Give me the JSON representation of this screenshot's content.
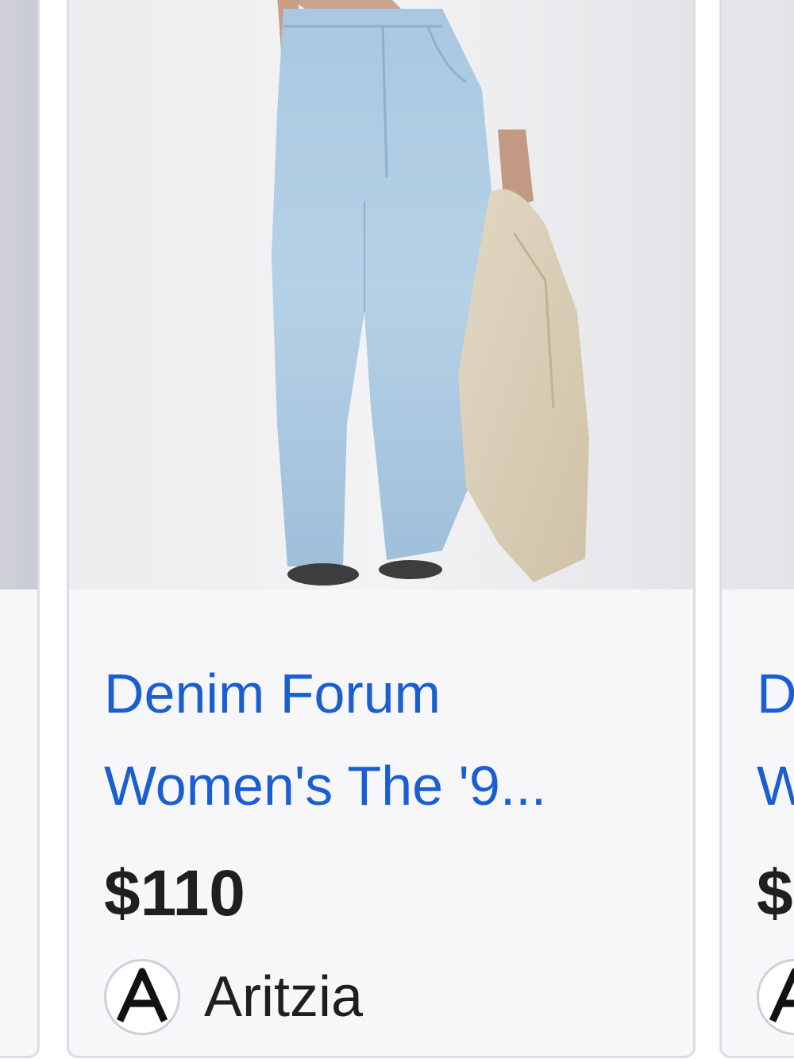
{
  "products": [
    {
      "title": "Denim Forum\nWomen's The '9...",
      "price": "$110",
      "merchant": "Aritzia",
      "merchant_logo_letter": "A",
      "image_alt": "Light wash relaxed jeans"
    }
  ],
  "peek_right": {
    "title": "D\nW",
    "price": "$",
    "merchant_logo_letter": "A"
  },
  "colors": {
    "link": "#1a5fd2",
    "price": "#1f1f1f",
    "card_bg": "#f7f7f9",
    "card_border": "#dcdde3"
  }
}
